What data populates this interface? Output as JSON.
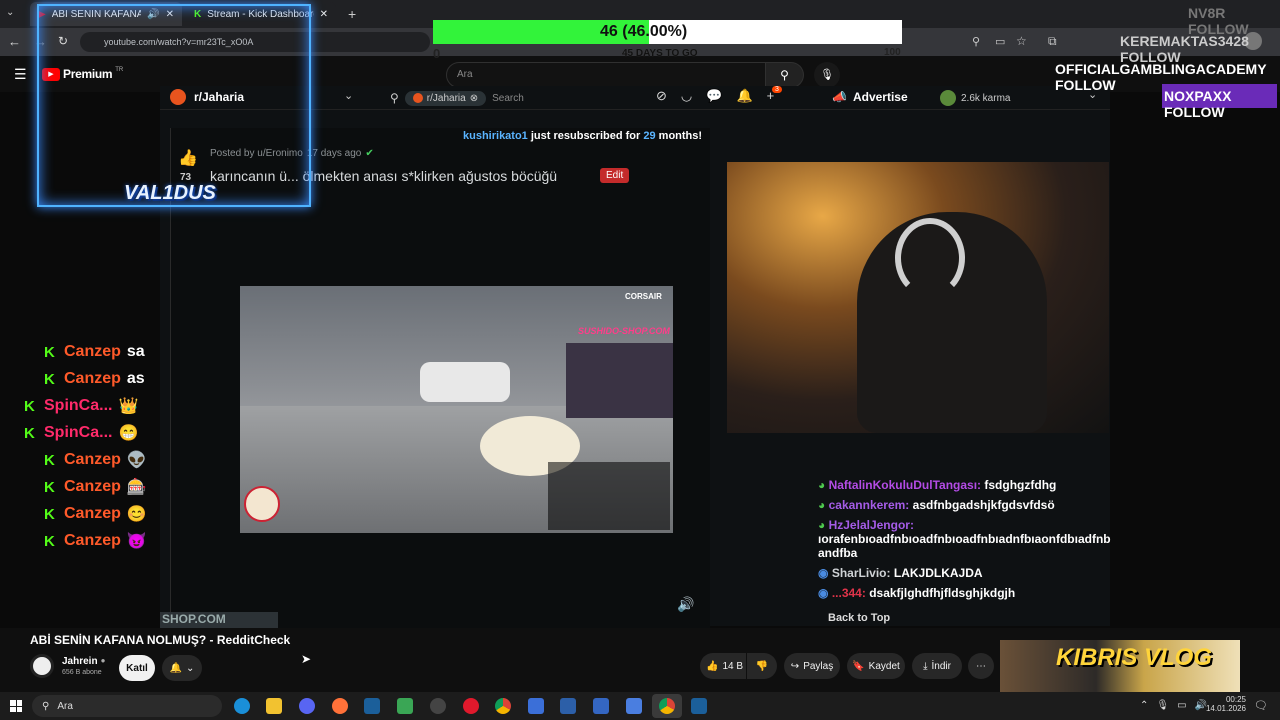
{
  "browser": {
    "tabs": [
      {
        "label": "ABİ SENİN KAFANA NOLMU"
      },
      {
        "label": "Stream - Kick Dashboard"
      }
    ],
    "url": "youtube.com/watch?v=mr23Tc_xO0A"
  },
  "youtube": {
    "logo_text": "Premium",
    "region": "TR",
    "search_placeholder": "Ara"
  },
  "overlay": {
    "progress_text": "46 (46.00%)",
    "progress_fraction": 0.46,
    "days_to_go": "45 DAYS TO GO",
    "progress_min": "0",
    "progress_max": "100",
    "follow_lines": [
      {
        "name": "NV8R",
        "action": "FOLLOW"
      },
      {
        "name": "KEREMAKTAS3428",
        "action": "FOLLOW"
      },
      {
        "name": "OFFICIALGAMBLINGACADEMY",
        "action": "FOLLOW"
      },
      {
        "name": "NOXPAXX",
        "action": "FOLLOW"
      }
    ],
    "val_logo": "VAL1DUS"
  },
  "reddit": {
    "subreddit": "r/Jaharia",
    "search_chip": "r/Jaharia",
    "search_placeholder": "Search",
    "advertise": "Advertise",
    "karma": "2.6k karma",
    "notif_count": "3",
    "resub": {
      "user": "kushirikato1",
      "text": "just resubscribed for",
      "months": "29",
      "suffix": "months!"
    },
    "post": {
      "votes": "73",
      "meta": "Posted by u/Eronimo",
      "age": "17 days ago",
      "title": "karıncanın ü... ölmekten anası s*klirken ağustos böcüğü",
      "edit": "Edit"
    },
    "meme_brand": "CORSAIR",
    "meme_site": "SUSHIDO-SHOP.COM",
    "back_to_top": "Back to Top",
    "shop_text": "SHOP.COM"
  },
  "stream_chat": [
    {
      "user": "NaftalinKokuluDulTangası:",
      "msg": "fsdghgzfdhg",
      "color": "#b44ce6"
    },
    {
      "user": "cakannkerem:",
      "msg": "asdfnbgadshjkfgdsvfdsö",
      "color": "#a55ce8"
    },
    {
      "user": "HzJelalJengor:",
      "msg": "ıorafenbıoadfnbıoadfnbıoadfnbıadnfbıaonfdbıadfnb andfba",
      "color": "#a55ce8"
    },
    {
      "user": "SharLivio:",
      "msg": "LAKJDLKAJDA",
      "color": "#cfd3d6"
    },
    {
      "user": "...344:",
      "msg": "dsakfjlghdfhjfldsghjkdgjh",
      "color": "#e0344a"
    }
  ],
  "kick_chat": [
    {
      "user": "Canzep",
      "msg": "sa",
      "color": "#ff5a2a"
    },
    {
      "user": "Canzep",
      "msg": "as",
      "color": "#ff5a2a"
    },
    {
      "user": "SpinCa...",
      "msg": "👑",
      "color": "#ff2a6a"
    },
    {
      "user": "SpinCa...",
      "msg": "😁",
      "color": "#ff2a6a"
    },
    {
      "user": "Canzep",
      "msg": "👽",
      "color": "#ff5a2a"
    },
    {
      "user": "Canzep",
      "msg": "🎰",
      "color": "#ff5a2a"
    },
    {
      "user": "Canzep",
      "msg": "😊",
      "color": "#ff5a2a"
    },
    {
      "user": "Canzep",
      "msg": "😈",
      "color": "#ff5a2a"
    }
  ],
  "video_info": {
    "title": "ABİ SENİN KAFANA NOLMUŞ? - RedditCheck",
    "channel": "Jahrein",
    "subs": "656 B abone",
    "join": "Katıl",
    "likes": "14 B",
    "share": "Paylaş",
    "save": "Kaydet",
    "download": "İndir",
    "rec_thumb": "KIBRIS VLOG"
  },
  "taskbar": {
    "search": "Ara",
    "time": "00:25",
    "date": "14.01.2026"
  }
}
